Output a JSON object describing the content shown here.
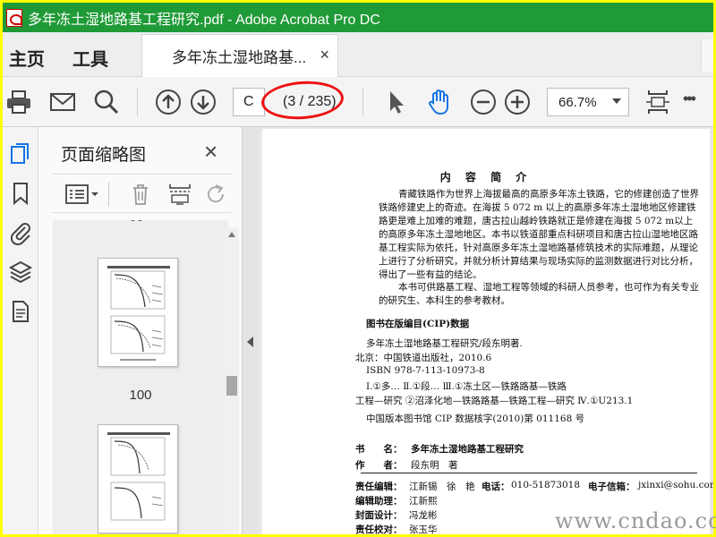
{
  "window": {
    "title": "多年冻土湿地路基工程研究.pdf - Adobe Acrobat Pro DC",
    "title_bar_color": "#1f9a37"
  },
  "tabs": {
    "home": "主页",
    "tools": "工具",
    "document": "多年冻土湿地路基...",
    "close": "×"
  },
  "toolbar": {
    "page_input": "C",
    "page_count": "(3 / 235)",
    "zoom": "66.7%",
    "more": "•••",
    "icons": [
      "print-icon",
      "email-icon",
      "search-icon",
      "prev-page-icon",
      "next-page-icon",
      "select-arrow-icon",
      "hand-icon",
      "zoom-out-icon",
      "zoom-in-icon",
      "fit-page-icon",
      "more-icon"
    ],
    "hand_color": "#1473e6"
  },
  "sidebar": {
    "icons": [
      "thumbnails-icon",
      "bookmarks-icon",
      "attachments-icon",
      "layers-icon",
      "document-icon"
    ]
  },
  "thumbnails": {
    "header": "页面缩略图",
    "close": "×",
    "page_label": "100"
  },
  "document": {
    "heading": "内 容 简 介",
    "para1": "青藏铁路作为世界上海拔最高的高原多年冻土铁路，它的修建创造了世界铁路修建史上的奇迹。在海拔 5 072 m 以上的高原多年冻土湿地地区修建铁路更是难上加难的难题，唐古拉山越岭铁路就正是修建在海拔 5 072 m以上的高原多年冻土湿地地区。本书以铁道部重点科研项目和唐古拉山湿地地区路基工程实际为依托，针对高原多年冻土湿地路基修筑技术的实际难题，从理论上进行了分析研究，并就分析计算结果与现场实际的监测数据进行对比分析，得出了一些有益的结论。",
    "para2": "本书可供路基工程、湿地工程等领域的科研人员参考，也可作为有关专业的研究生、本科生的参考教材。",
    "cip_title": "图书在版编目(CIP)数据",
    "cip1": "多年冻土湿地路基工程研究/段东明著.",
    "cip2": "北京：中国铁道出版社，2010.6",
    "cip3": "ISBN 978-7-113-10973-8",
    "cip4": "Ⅰ.①多… Ⅱ.①段… Ⅲ.①冻土区—铁路路基—铁路",
    "cip5": "工程—研究 ②沼泽化地—铁路路基—铁路工程—研究 Ⅳ.①U213.1",
    "cip6": "中国版本图书馆 CIP 数据核字(2010)第 011168 号",
    "book_label": "书　　名：",
    "book_value": "多年冻土湿地路基工程研究",
    "author_label": "作　　者：",
    "author_value": "段东明　著",
    "editor_label": "责任编辑：",
    "editor_value": "江新锡　徐　艳",
    "phone_label": "电话：",
    "phone_value": "010-51873018",
    "email_label": "电子信箱：",
    "email_value": "jxinxi@sohu.com",
    "assist_label": "编辑助理：",
    "assist_value": "江新熙",
    "cover_label": "封面设计：",
    "cover_value": "冯龙彬",
    "proof_label": "责任校对：",
    "proof_value": "张玉华"
  },
  "watermark": "www.cndao.com"
}
